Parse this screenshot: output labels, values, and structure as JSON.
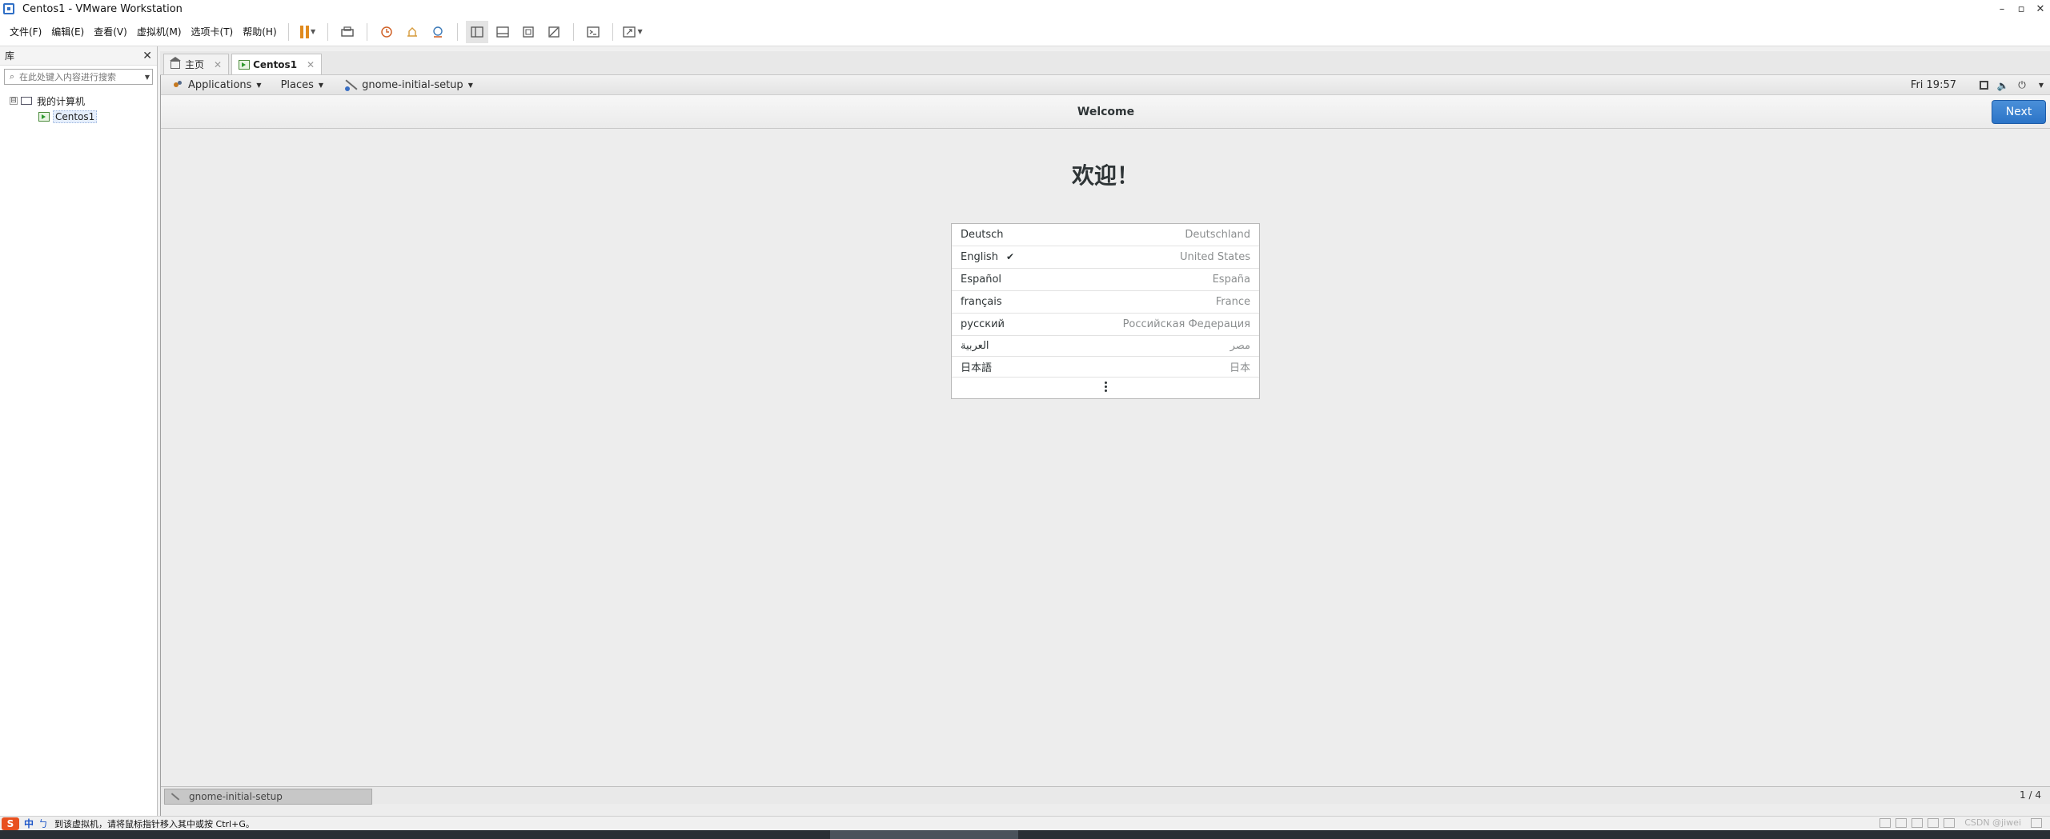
{
  "window": {
    "title": "Centos1 - VMware Workstation",
    "controls": [
      "–",
      "▫",
      "✕"
    ]
  },
  "menubar": {
    "items": [
      "文件(F)",
      "编辑(E)",
      "查看(V)",
      "虚拟机(M)",
      "选项卡(T)",
      "帮助(H)"
    ]
  },
  "library": {
    "title": "库",
    "close": "✕",
    "search_placeholder": "在此处键入内容进行搜索",
    "tree": {
      "root": "我的计算机",
      "toggle": "⊟",
      "child": "Centos1"
    }
  },
  "vm_tabs": [
    {
      "label": "主页",
      "close": "✕"
    },
    {
      "label": "Centos1",
      "close": "✕"
    }
  ],
  "gnome_bar": {
    "applications": "Applications",
    "places": "Places",
    "app_name": "gnome-initial-setup",
    "clock": "Fri 19:57"
  },
  "header": {
    "title": "Welcome",
    "next": "Next"
  },
  "welcome": {
    "heading": "欢迎！",
    "languages": [
      {
        "name": "Deutsch",
        "region": "Deutschland",
        "selected": false
      },
      {
        "name": "English",
        "region": "United States",
        "selected": true
      },
      {
        "name": "Español",
        "region": "España",
        "selected": false
      },
      {
        "name": "français",
        "region": "France",
        "selected": false
      },
      {
        "name": "русский",
        "region": "Российская Федерация",
        "selected": false
      },
      {
        "name": "العربية",
        "region": "مصر",
        "selected": false
      },
      {
        "name": "日本語",
        "region": "日本",
        "selected": false
      }
    ],
    "check": "✔"
  },
  "guest_bottom": {
    "task": "gnome-initial-setup",
    "pager": "1 / 4"
  },
  "statusbar": {
    "ime_logo": "S",
    "ime_mode": "中",
    "ime_punct": "ㄅ",
    "message": "到该虚拟机，请将鼠标指针移入其中或按 Ctrl+G。",
    "watermark": "CSDN @jiwei"
  }
}
